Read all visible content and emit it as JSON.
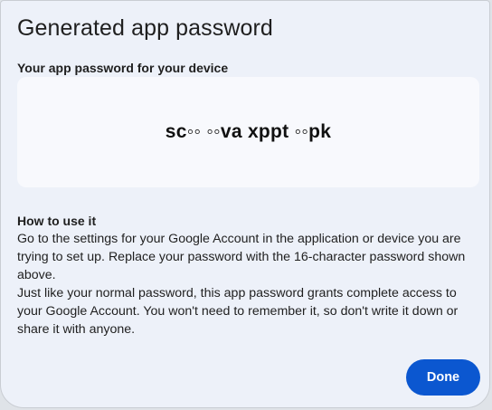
{
  "dialog": {
    "title": "Generated app password",
    "password_label": "Your app password for your device",
    "password_value": "sc◦◦ ◦◦va xppt ◦◦pk",
    "howto": {
      "title": "How to use it",
      "paragraph1": "Go to the settings for your Google Account in the application or device you are trying to set up. Replace your password with the 16-character password shown above.",
      "paragraph2": "Just like your normal password, this app password grants complete access to your Google Account. You won't need to remember it, so don't write it down or share it with anyone."
    },
    "done_label": "Done"
  },
  "colors": {
    "dialog_background": "#edf1f9",
    "password_box_background": "#f8f9fd",
    "primary_button": "#0b57d0",
    "text": "#1f1f1f"
  }
}
